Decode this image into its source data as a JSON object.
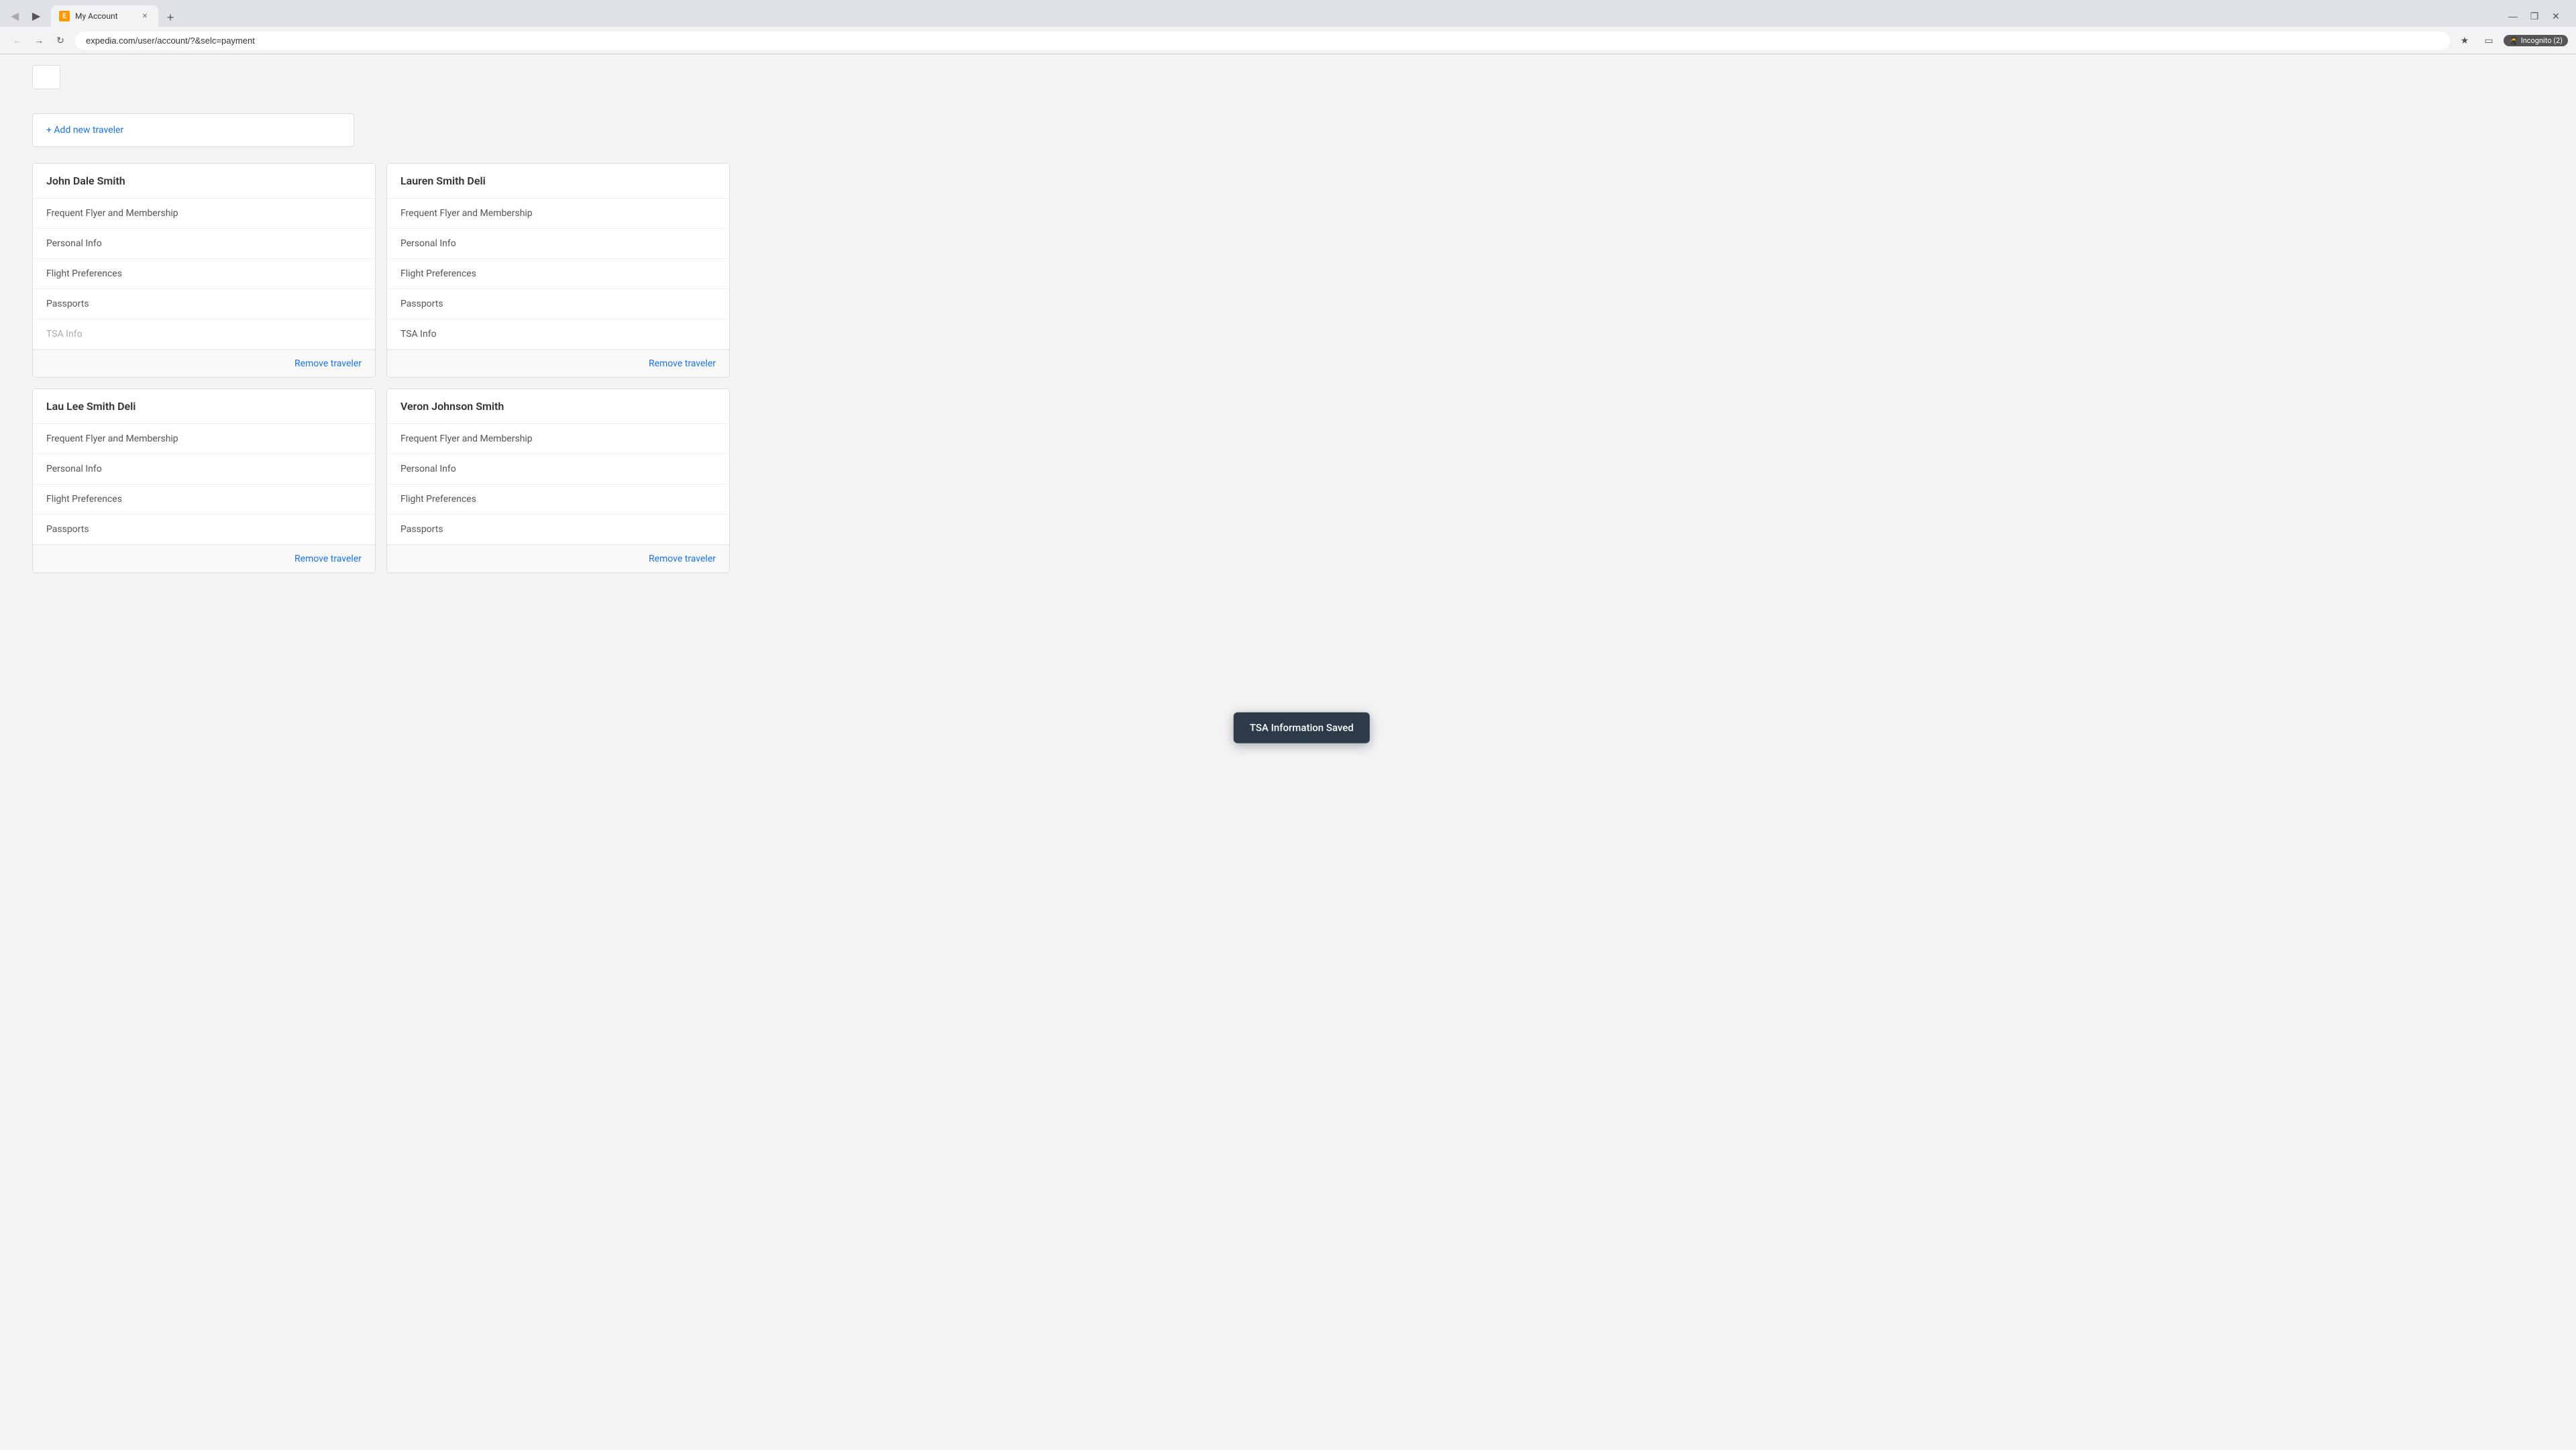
{
  "browser": {
    "tab_title": "My Account",
    "tab_favicon": "E",
    "url": "expedia.com/user/account/?&selc=payment",
    "new_tab_label": "+",
    "window_controls": {
      "minimize": "—",
      "maximize": "❐",
      "close": "✕"
    },
    "nav": {
      "back": "←",
      "forward": "→",
      "reload": "↻"
    },
    "incognito_label": "Incognito (2)"
  },
  "page": {
    "add_traveler_label": "+ Add new traveler",
    "toast_message": "TSA Information Saved",
    "travelers": [
      {
        "id": "john-dale-smith",
        "name": "John Dale Smith",
        "menu_items": [
          {
            "id": "frequent-flyer-1",
            "label": "Frequent Flyer and Membership",
            "disabled": false
          },
          {
            "id": "personal-info-1",
            "label": "Personal Info",
            "disabled": false
          },
          {
            "id": "flight-prefs-1",
            "label": "Flight Preferences",
            "disabled": false
          },
          {
            "id": "passports-1",
            "label": "Passports",
            "disabled": false
          },
          {
            "id": "tsa-info-1",
            "label": "TSA Info",
            "disabled": true
          }
        ],
        "remove_label": "Remove traveler"
      },
      {
        "id": "lauren-smith-deli",
        "name": "Lauren Smith Deli",
        "menu_items": [
          {
            "id": "frequent-flyer-2",
            "label": "Frequent Flyer and Membership",
            "disabled": false
          },
          {
            "id": "personal-info-2",
            "label": "Personal Info",
            "disabled": false
          },
          {
            "id": "flight-prefs-2",
            "label": "Flight Preferences",
            "disabled": false
          },
          {
            "id": "passports-2",
            "label": "Passports",
            "disabled": false
          },
          {
            "id": "tsa-info-2",
            "label": "TSA Info",
            "disabled": false
          }
        ],
        "remove_label": "Remove traveler"
      },
      {
        "id": "lau-lee-smith-deli",
        "name": "Lau Lee Smith Deli",
        "menu_items": [
          {
            "id": "frequent-flyer-3",
            "label": "Frequent Flyer and Membership",
            "disabled": false
          },
          {
            "id": "personal-info-3",
            "label": "Personal Info",
            "disabled": false
          },
          {
            "id": "flight-prefs-3",
            "label": "Flight Preferences",
            "disabled": false
          },
          {
            "id": "passports-3",
            "label": "Passports",
            "disabled": false
          }
        ],
        "remove_label": "Remove traveler"
      },
      {
        "id": "veron-johnson-smith",
        "name": "Veron Johnson Smith",
        "menu_items": [
          {
            "id": "frequent-flyer-4",
            "label": "Frequent Flyer and Membership",
            "disabled": false
          },
          {
            "id": "personal-info-4",
            "label": "Personal Info",
            "disabled": false
          },
          {
            "id": "flight-prefs-4",
            "label": "Flight Preferences",
            "disabled": false
          },
          {
            "id": "passports-4",
            "label": "Passports",
            "disabled": false
          }
        ],
        "remove_label": "Remove traveler"
      }
    ]
  }
}
